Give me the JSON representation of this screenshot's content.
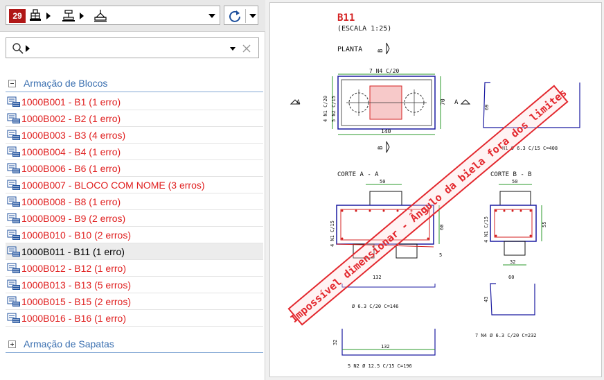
{
  "toolbar": {
    "count_badge": "29",
    "crumbs": [
      "building-icon",
      "floor-icon",
      "foundation-icon"
    ]
  },
  "search": {
    "value": "",
    "placeholder": ""
  },
  "groups": [
    {
      "label": "Armação de Blocos",
      "expanded": true,
      "items": [
        {
          "label": "1000B001 - B1 (1 erro)",
          "error": true
        },
        {
          "label": "1000B002 - B2 (1 erro)",
          "error": true
        },
        {
          "label": "1000B003 - B3 (4 erros)",
          "error": true
        },
        {
          "label": "1000B004 - B4 (1 erro)",
          "error": true
        },
        {
          "label": "1000B006 - B6 (1 erro)",
          "error": true
        },
        {
          "label": "1000B007 - BLOCO COM NOME (3 erros)",
          "error": true
        },
        {
          "label": "1000B008 - B8 (1 erro)",
          "error": true
        },
        {
          "label": "1000B009 - B9 (2 erros)",
          "error": true
        },
        {
          "label": "1000B010 - B10 (2 erros)",
          "error": true
        },
        {
          "label": "1000B011 - B11 (1 erro)",
          "error": false,
          "selected": true
        },
        {
          "label": "1000B012 - B12 (1 erro)",
          "error": true
        },
        {
          "label": "1000B013 - B13 (5 erros)",
          "error": true
        },
        {
          "label": "1000B015 - B15 (2 erros)",
          "error": true
        },
        {
          "label": "1000B016 - B16 (1 erro)",
          "error": true
        }
      ]
    },
    {
      "label": "Armação de Sapatas",
      "expanded": false,
      "items": []
    }
  ],
  "drawing": {
    "title": "B11",
    "scale": "(ESCALA 1:25)",
    "planta": "PLANTA",
    "corte_a": "CORTE  A - A",
    "corte_b": "CORTE  B - B",
    "marker_a": "A",
    "marker_b": "B",
    "dims": {
      "top_bar": "7 N4 C/20",
      "width_140": "140",
      "height_70": "70",
      "side_bars_1": "4 N1 C/20",
      "side_bars_2": "5 N2 C/15",
      "d50a": "50",
      "d50b": "50",
      "d60": "60",
      "d55": "55",
      "d32a": "32",
      "d132a": "132",
      "d132b": "132",
      "d60b": "60",
      "d32b": "32",
      "d69": "69",
      "d43": "43",
      "d4n1a": "4 N1 C/15",
      "d4n1b": "4 N1 C/15",
      "d5": "5"
    },
    "notes": {
      "n1": "N1 Ø 6.3 C/15 C=408",
      "n3": "Ø 6.3 C/20 C=146",
      "n4": "7 N4 Ø 6.3 C/20 C=232",
      "n2": "5 N2 Ø 12.5 C/15 C=196"
    },
    "error_stamp": "Impossível dimensionar - Ângulo da biela fora dos limites",
    "colors": {
      "stamp": "#e3282e",
      "beam": "#1a1aa0",
      "rebar_red": "#d42020",
      "green": "#2a9a2a"
    }
  }
}
